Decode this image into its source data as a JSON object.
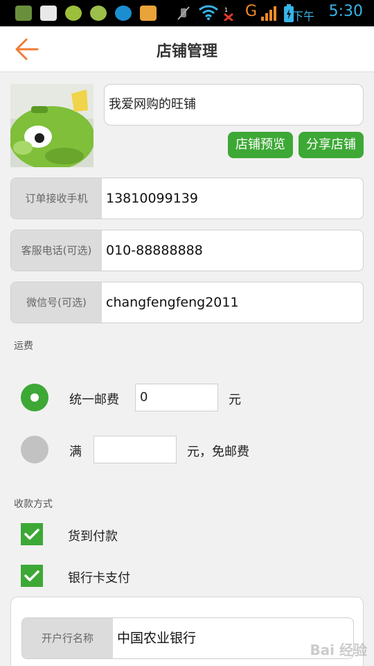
{
  "status_bar": {
    "icons": [
      "mail-icon",
      "youku-icon",
      "app-icon",
      "wechat-icon",
      "app2-icon",
      "browser-icon",
      "mute-icon",
      "wifi-icon",
      "no-signal-icon",
      "signal-icon",
      "battery-icon"
    ],
    "network": "G",
    "ampm": "下午",
    "time": "5:30"
  },
  "header": {
    "title": "店铺管理",
    "accent": "#f07b33"
  },
  "shop": {
    "name": "我爱网购的旺铺",
    "preview_button": "店铺预览",
    "share_button": "分享店铺"
  },
  "fields": [
    {
      "label": "订单接收手机",
      "value": "13810099139"
    },
    {
      "label": "客服电话(可选)",
      "value": "010-88888888"
    },
    {
      "label": "微信号(可选)",
      "value": "changfengfeng2011"
    }
  ],
  "shipping": {
    "section_title": "运费",
    "flat": {
      "label": "统一邮费",
      "value": "0",
      "unit": "元",
      "selected": true
    },
    "free_over": {
      "prefix": "满",
      "value": "",
      "suffix": "元，免邮费",
      "selected": false
    }
  },
  "payment": {
    "section_title": "收款方式",
    "options": [
      {
        "label": "货到付款",
        "checked": true
      },
      {
        "label": "银行卡支付",
        "checked": true
      }
    ]
  },
  "bank": {
    "label": "开户行名称",
    "value": "中国农业银行"
  },
  "watermark": "Bai 经验",
  "colors": {
    "green": "#3da836",
    "orange": "#f07b33",
    "time_blue": "#37b4e8"
  }
}
